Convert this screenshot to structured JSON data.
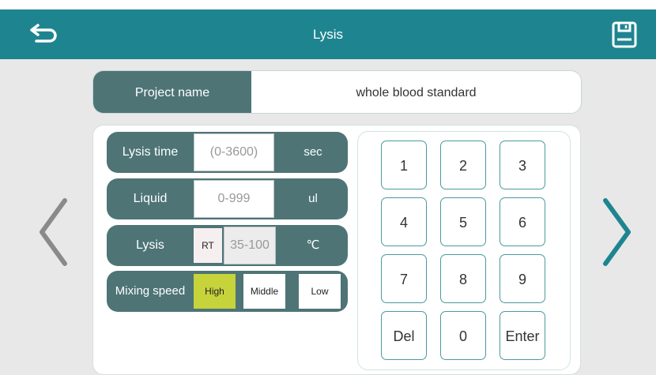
{
  "header": {
    "title": "Lysis"
  },
  "project": {
    "label": "Project name",
    "value": "whole blood standard"
  },
  "params": {
    "lysis_time": {
      "label": "Lysis time",
      "placeholder": "(0-3600)",
      "unit": "sec"
    },
    "liquid": {
      "label": "Liquid",
      "placeholder": "0-999",
      "unit": "ul"
    },
    "lysis": {
      "label": "Lysis",
      "rt": "RT",
      "placeholder": "35-100",
      "unit": "℃"
    },
    "mixing": {
      "label": "Mixing speed",
      "options": [
        "High",
        "Middle",
        "Low"
      ],
      "selected": "High"
    }
  },
  "keypad": {
    "keys": [
      "1",
      "2",
      "3",
      "4",
      "5",
      "6",
      "7",
      "8",
      "9",
      "Del",
      "0",
      "Enter"
    ]
  },
  "colors": {
    "header": "#1e8590",
    "label_bg": "#4e7476",
    "selected": "#c6d33b",
    "arrow_right": "#1e8590",
    "arrow_left": "#8a8a8a"
  },
  "icons": {
    "back": "back-arrow-icon",
    "save": "save-icon",
    "prev": "chevron-left-icon",
    "next": "chevron-right-icon"
  }
}
